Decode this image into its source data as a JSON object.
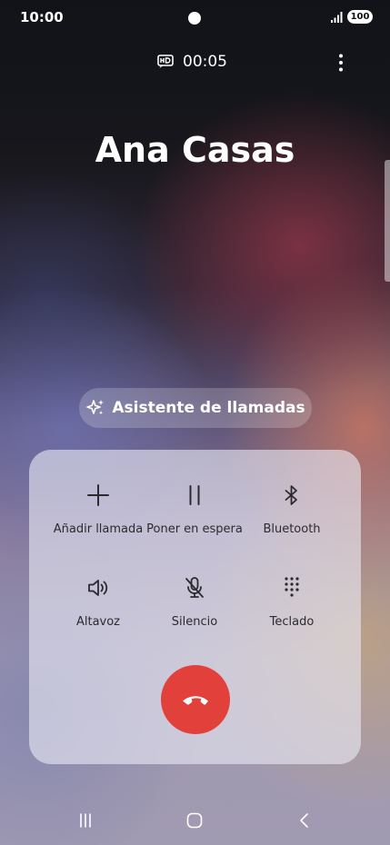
{
  "status_bar": {
    "time": "10:00",
    "battery": "100",
    "icons": [
      "camera-dot",
      "signal-icon"
    ]
  },
  "call": {
    "hd_icon": "hd-voice-icon",
    "timer": "00:05",
    "contact_name": "Ana Casas",
    "menu_icon": "more-vertical-icon"
  },
  "assistant": {
    "icon": "sparkle-icon",
    "label": "Asistente de llamadas"
  },
  "controls": [
    {
      "id": "add-call",
      "icon": "plus-icon",
      "label": "Añadir llamada"
    },
    {
      "id": "hold",
      "icon": "pause-icon",
      "label": "Poner en espera"
    },
    {
      "id": "bluetooth",
      "icon": "bluetooth-icon",
      "label": "Bluetooth"
    },
    {
      "id": "speaker",
      "icon": "speaker-icon",
      "label": "Altavoz"
    },
    {
      "id": "mute",
      "icon": "mic-off-icon",
      "label": "Silencio"
    },
    {
      "id": "keypad",
      "icon": "dialpad-icon",
      "label": "Teclado"
    }
  ],
  "end_call": {
    "icon": "end-call-icon",
    "color": "#e2403a"
  },
  "nav_bar": {
    "icons": [
      "recents-icon",
      "home-icon",
      "back-icon"
    ]
  }
}
